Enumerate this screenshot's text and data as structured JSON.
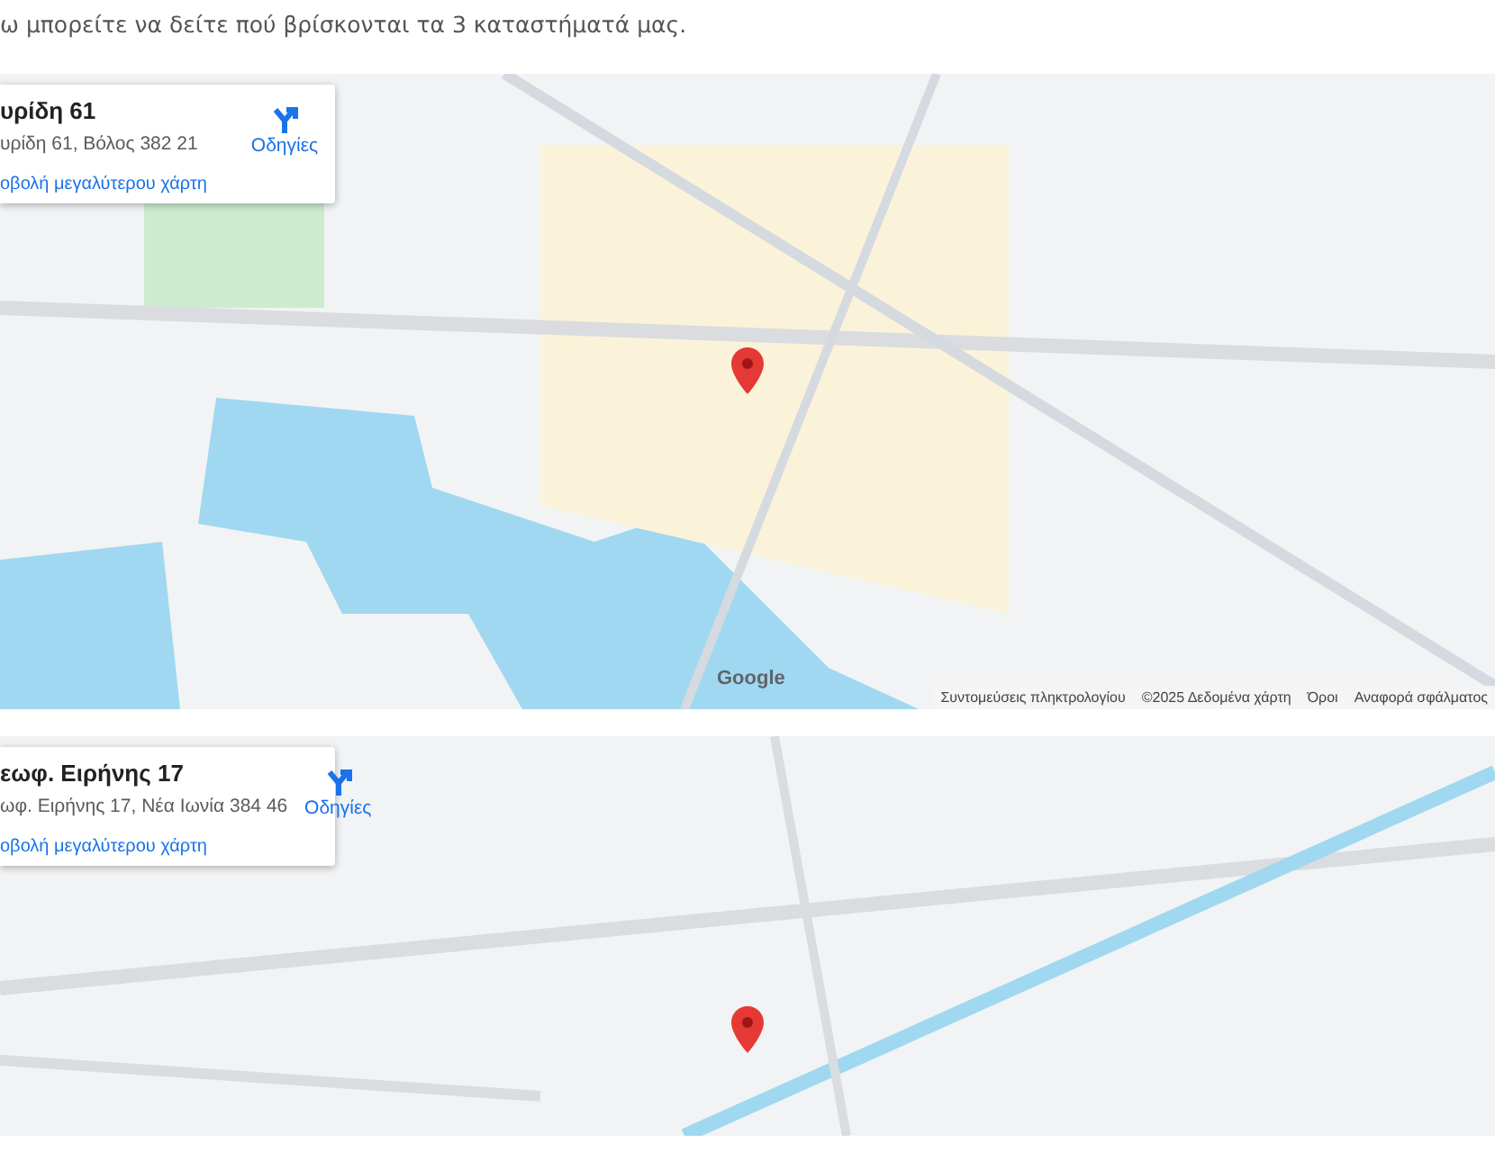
{
  "intro": "ω μπορείτε να δείτε πού βρίσκονται τα 3 καταστήματά μας.",
  "maps": [
    {
      "kind": "large",
      "title": "υρίδη 61",
      "address": "υρίδη 61, Βόλος 382 21",
      "directions": "Οδηγίες",
      "larger_map_link": "οβολή μεγαλύτερου χάρτη",
      "logo": "Google",
      "attribution": [
        "Συντομεύσεις πληκτρολογίου",
        "©2025 Δεδομένα χάρτη",
        "Όροι",
        "Αναφορά σφάλματος"
      ]
    },
    {
      "kind": "small",
      "title": "εωφ. Ειρήνης 17",
      "address": "ωφ. Ειρήνης 17, Νέα Ιωνία 384 46",
      "directions": "Οδηγίες",
      "larger_map_link": "οβολή μεγαλύτερου χάρτη"
    }
  ]
}
